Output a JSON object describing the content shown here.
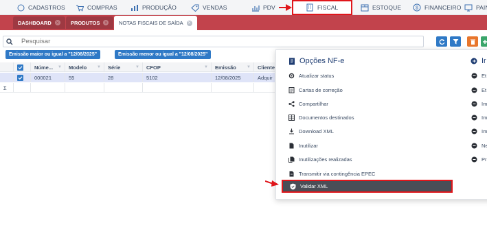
{
  "menu": {
    "items": [
      {
        "label": "CADASTROS",
        "icon": "circle-icon"
      },
      {
        "label": "COMPRAS",
        "icon": "cart-icon"
      },
      {
        "label": "PRODUÇÃO",
        "icon": "bar-chart-icon"
      },
      {
        "label": "VENDAS",
        "icon": "tag-icon"
      },
      {
        "label": "PDV",
        "icon": "chart-icon"
      },
      {
        "label": "FISCAL",
        "icon": "building-icon"
      },
      {
        "label": "ESTOQUE",
        "icon": "box-icon"
      },
      {
        "label": "FINANCEIRO",
        "icon": "dollar-icon"
      },
      {
        "label": "PAINÉ",
        "icon": "monitor-icon"
      }
    ],
    "active": "FISCAL",
    "highlight_color": "#e0161b"
  },
  "tabs": [
    {
      "label": "DASHBOARD"
    },
    {
      "label": "PRODUTOS"
    },
    {
      "label": "NOTAS FISCAIS DE SAÍDA"
    }
  ],
  "search": {
    "placeholder": "Pesquisar",
    "value": ""
  },
  "filters": [
    {
      "label": "Emissão maior ou igual a \"12/08/2025\""
    },
    {
      "label": "Emissão menor ou igual a \"12/08/2025\""
    }
  ],
  "table": {
    "columns": [
      "Núme...",
      "Modelo",
      "Série",
      "CFOP",
      "Emissão",
      "Cliente"
    ],
    "rows": [
      [
        "000021",
        "55",
        "28",
        "5102",
        "12/08/2025",
        "Adquir"
      ]
    ],
    "summary_symbol": "Σ"
  },
  "panel": {
    "title": "Opções NF-e",
    "options": [
      {
        "label": "Atualizar status",
        "icon": "refresh-gear-icon"
      },
      {
        "label": "Cartas de correção",
        "icon": "document-list-icon"
      },
      {
        "label": "Compartilhar",
        "icon": "share-icon"
      },
      {
        "label": "Documentos destinados",
        "icon": "table-icon"
      },
      {
        "label": "Download XML",
        "icon": "download-icon"
      },
      {
        "label": "Inutilizar",
        "icon": "file-icon"
      },
      {
        "label": "Inutilizações realizadas",
        "icon": "files-icon"
      },
      {
        "label": "Transmitir via contingência EPEC",
        "icon": "file-send-icon"
      }
    ],
    "highlighted_option": {
      "label": "Validar XML",
      "icon": "shield-check-icon"
    },
    "right_title": "Ir",
    "right_options": [
      "Et",
      "Et",
      "Im",
      "Im",
      "Im",
      "Ne",
      "Pr"
    ]
  },
  "colors": {
    "tabbar": "#c2434c",
    "accent_blue": "#2f79c6",
    "title_blue": "#1e3c72",
    "highlight_red": "#e0161b"
  }
}
